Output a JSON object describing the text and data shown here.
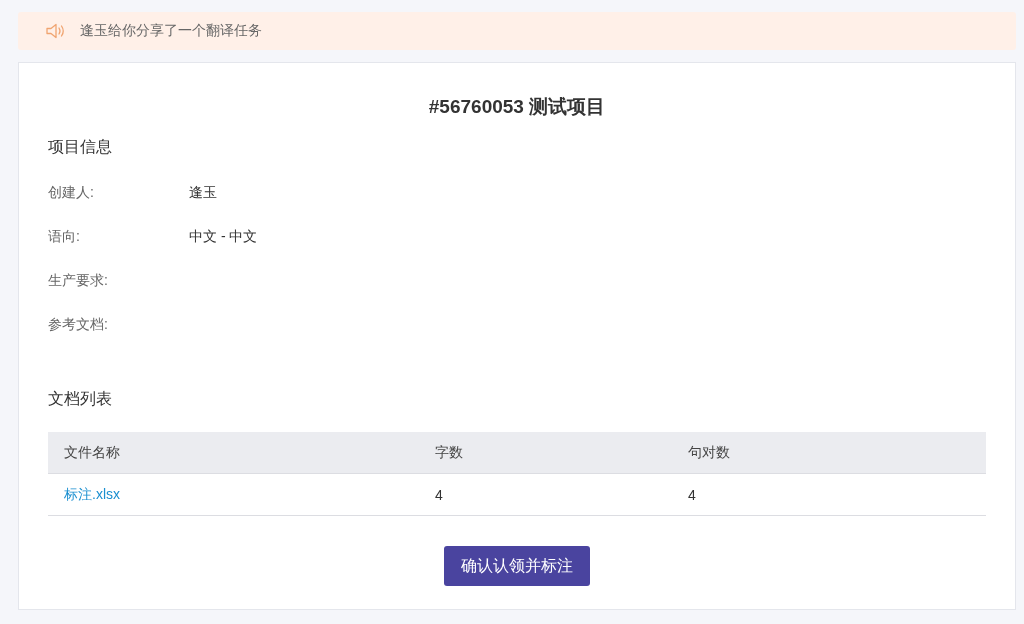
{
  "notice": {
    "text": "逢玉给你分享了一个翻译任务"
  },
  "project": {
    "title": "#56760053 测试项目"
  },
  "info": {
    "heading": "项目信息",
    "fields": [
      {
        "label": "创建人:",
        "value": "逢玉"
      },
      {
        "label": "语向:",
        "value": "中文 - 中文"
      },
      {
        "label": "生产要求:"
      },
      {
        "label": "参考文档:"
      }
    ]
  },
  "documents": {
    "heading": "文档列表",
    "table": {
      "columns": [
        "文件名称",
        "字数",
        "句对数"
      ],
      "rows": [
        {
          "cells": [
            "标注.xlsx",
            "4",
            "4"
          ]
        }
      ]
    }
  },
  "buttons": [
    "确认认领并标注"
  ]
}
